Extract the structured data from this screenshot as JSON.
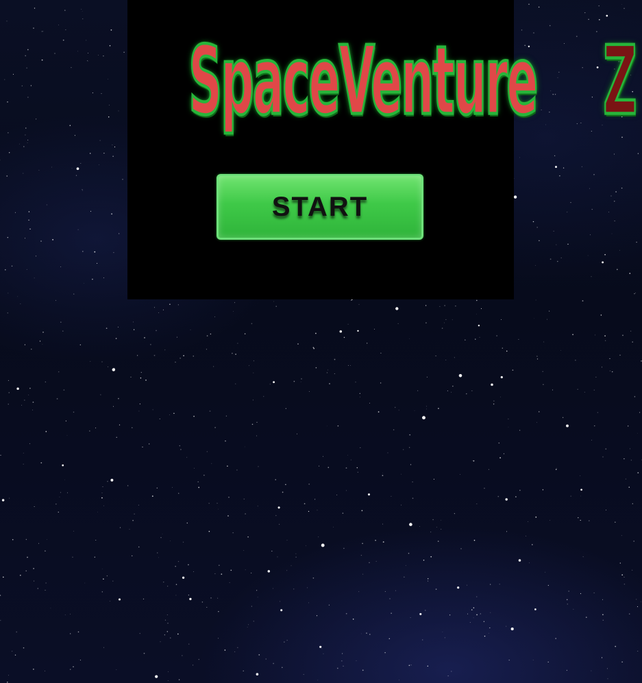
{
  "game": {
    "title_main": "SpaceVenture",
    "title_z": "Z",
    "start_label": "START"
  },
  "colors": {
    "title_red": "#e04848",
    "title_z": "#7a1414",
    "title_outline": "#27b53a",
    "button_green": "#3fc948",
    "panel": "#000000",
    "space": "#070b1c"
  }
}
